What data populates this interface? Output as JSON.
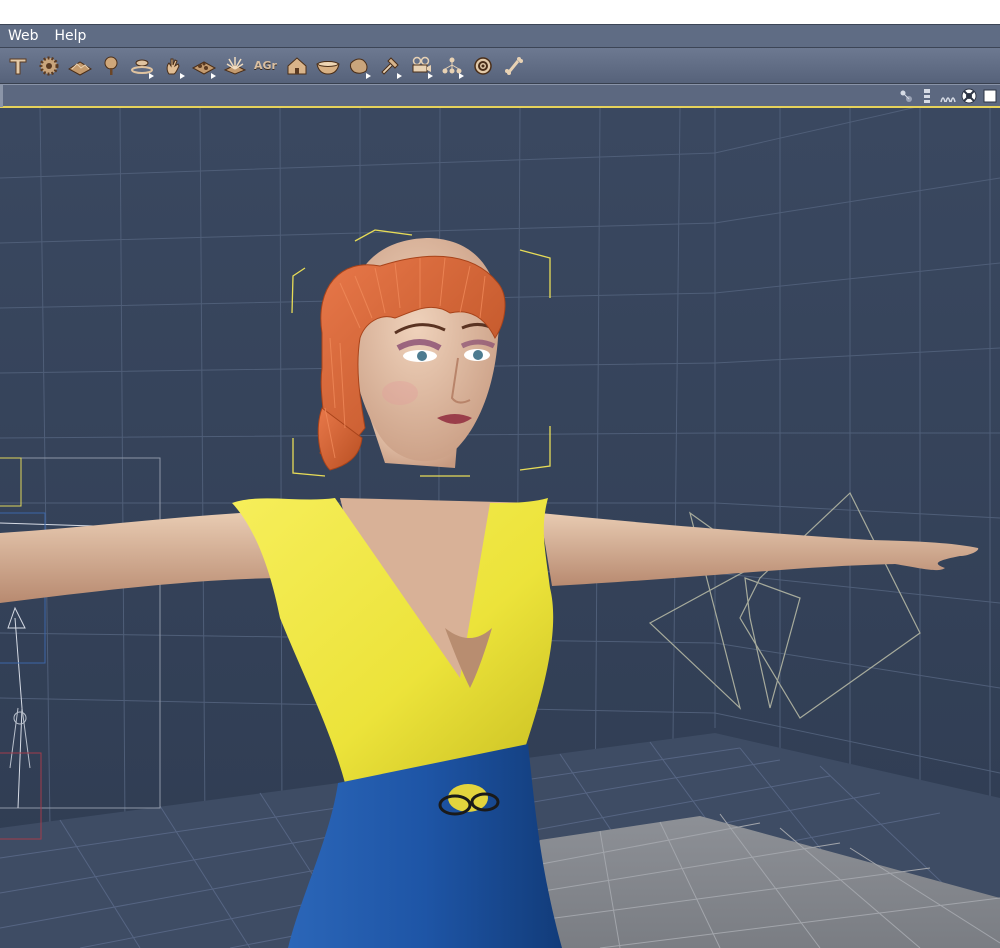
{
  "menu": {
    "items": [
      "Web",
      "Help"
    ]
  },
  "toolbar": {
    "tools": [
      {
        "icon": "text-tool-icon"
      },
      {
        "icon": "gear-tool-icon"
      },
      {
        "icon": "terrain-icon"
      },
      {
        "icon": "tree-icon"
      },
      {
        "icon": "cloud-ring-icon",
        "menu": true
      },
      {
        "icon": "hand-icon",
        "menu": true
      },
      {
        "icon": "rock-cluster-icon",
        "menu": true
      },
      {
        "icon": "plant-icon"
      },
      {
        "icon": "agr-text-icon",
        "label": "AGr"
      },
      {
        "icon": "house-icon"
      },
      {
        "icon": "bowl-icon"
      },
      {
        "icon": "stone-icon",
        "menu": true
      },
      {
        "icon": "hammer-icon",
        "menu": true
      },
      {
        "icon": "camera-icon",
        "menu": true
      },
      {
        "icon": "network-icon",
        "menu": true
      },
      {
        "icon": "target-icon"
      },
      {
        "icon": "bone-icon"
      }
    ]
  },
  "viewport_controls": {
    "icons": [
      "light-controls-icon",
      "sort-icon",
      "render-style-icon",
      "reset-view-icon",
      "color-swatch-icon"
    ]
  },
  "scene": {
    "background_color": "#35435a",
    "floor_color": "#8c8f95",
    "dress_top_color": "#f2ea3f",
    "dress_bottom_color": "#1e55a6",
    "hair_color": "#d9683a"
  }
}
